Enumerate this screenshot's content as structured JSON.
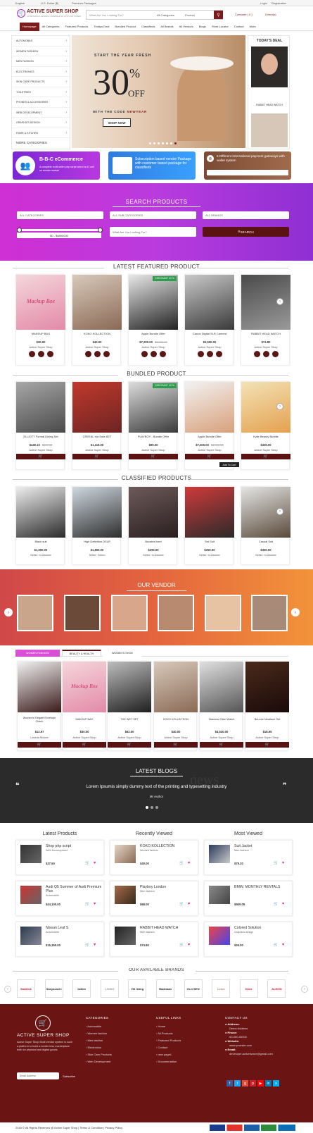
{
  "topbar": {
    "lang": "English",
    "currency": "U.S. Dollar ($)",
    "premium": "Premium Packages",
    "login": "Login",
    "register": "Registration"
  },
  "header": {
    "brand": "ACTIVE SUPER SHOP",
    "tagline": "ULTIMATE MULTI-VENDOR E-COMMERCE SOLUTION FOR OWNERS",
    "search_placeholder": "What Are You Looking For?",
    "category_select": "All Categories",
    "type_select": "Product",
    "compare": "Compare ( 0 )",
    "cart": "0 item(s)"
  },
  "nav": [
    "Homepage",
    "All Categories",
    "Featured Products",
    "Todays Deal",
    "Bundled Product",
    "Classifieds",
    "All Brands",
    "All Vendors",
    "Blogs",
    "Store Locator",
    "Contact",
    "More"
  ],
  "categories": [
    "AUTOMOBILE",
    "WOMEN FASHION",
    "MEN FASHION",
    "ELECTRONICS",
    "SKIN CARE PRODUCTS",
    "TOILETRIES",
    "PHONES & ACCESSORIES",
    "WEB DEVELOPMENT",
    "GRAPHICS DESIGN",
    "HOME & KITCHEN"
  ],
  "more_categories": "MORE CATEGORIES",
  "hero": {
    "line1": "START THE YEAR FRESH",
    "big": "30",
    "pct": "%",
    "off": "OFF",
    "code_text": "WITH THE CODE",
    "code": "NEWYEAR",
    "button": "SHOP NOW"
  },
  "todays_deal": {
    "title": "TODAY'S DEAL",
    "item": "RABBIT HEAD WATCH"
  },
  "promos": [
    {
      "title": "B-B-C eCommerce",
      "text": "A complete multi seller php script which is #1 sell on envato market"
    },
    {
      "text": "Subscription based vendor Package with customer based package for classifieds"
    },
    {
      "text": "5 Different International payment gateways with wallet system"
    }
  ],
  "search_products": {
    "title": "SEARCH PRODUCTS",
    "cat": "ALL CATEGORIES",
    "subcat": "ALL SUB CATEGORIES",
    "brand": "ALL BRANDS",
    "range": "$0 - $4890000",
    "placeholder": "What Are You Looking For?",
    "button": "SEARCH"
  },
  "featured": {
    "title": "LATEST FEATURED PRODUCT",
    "badge": "DISCOUNT 10 %",
    "items": [
      {
        "name": "MAKEUP BAG",
        "price": "$30.00",
        "old": "",
        "seller": "Active Super Shop",
        "img": "Mackup Box"
      },
      {
        "name": "KOKO KOLLECTION",
        "price": "$40.00",
        "old": "",
        "seller": "Active Super Shop",
        "img": ""
      },
      {
        "name": "Apple Bundle Offer",
        "price": "$7,200.00",
        "old": "$8,000.00",
        "seller": "Active Super Shop",
        "img": ""
      },
      {
        "name": "Canon Digital SLR Camera",
        "price": "$3,500.00",
        "old": "",
        "seller": "Active Super Shop",
        "img": ""
      },
      {
        "name": "RABBIT HEAD WATCH",
        "price": "$74.80",
        "old": "",
        "seller": "Active Super Shop",
        "img": ""
      }
    ]
  },
  "bundled": {
    "title": "BUNDLED PRODUCT",
    "badge": "DISCOUNT 10 %",
    "tooltip": "Add To Cart",
    "items": [
      {
        "name": "ELLIOTT Formal Dining Set",
        "price": "$449.10",
        "old": "$499.00",
        "seller": "Active Super Shop"
      },
      {
        "name": "CREEAL n/a Sofa SET",
        "price": "$1,119.00",
        "old": "",
        "seller": "Active Super Shop"
      },
      {
        "name": "PLAYBOY - Bundle Offer",
        "price": "$99.00",
        "old": "",
        "seller": "Active Super Shop"
      },
      {
        "name": "Apple Bundle Offer",
        "price": "$7,200.00",
        "old": "$8,000.00",
        "seller": "Active Super Shop"
      },
      {
        "name": "Kylie Beauty Bundle",
        "price": "$300.00",
        "old": "",
        "seller": "Active Super Shop"
      }
    ]
  },
  "classified": {
    "title": "CLASSIFIED PRODUCTS",
    "items": [
      {
        "name": "Black suit",
        "price": "$1,000.00",
        "seller": "Seller: Customer"
      },
      {
        "name": "High Definition DSLR",
        "price": "$1,800.00",
        "seller": "Seller: Demo"
      },
      {
        "name": "Boosted heel",
        "price": "$290.00",
        "seller": "Seller: Customer"
      },
      {
        "name": "Set Suit",
        "price": "$250.00",
        "seller": "Seller: Customer"
      },
      {
        "name": "Casual Suit",
        "price": "$350.00",
        "seller": "Seller: Customer"
      }
    ]
  },
  "vendor": {
    "title": "OUR VENDOR"
  },
  "tabs": {
    "labels": [
      "WOMEN FASHION",
      "BEAUTY & HEALTH",
      "WOMEN'S SHOE"
    ],
    "items": [
      {
        "name": "Women's Elegant Envelope Clutch",
        "price": "$12.97",
        "seller": "Lavinia Mckee",
        "img": ""
      },
      {
        "name": "MAKEUP BAG",
        "price": "$30.00",
        "seller": "Active Super Shop",
        "img": "Mackup Box"
      },
      {
        "name": "THE WET SET",
        "price": "$62.00",
        "seller": "Active Super Shop",
        "img": ""
      },
      {
        "name": "KOKO KOLLECTION",
        "price": "$40.00",
        "seller": "Active Super Shop",
        "img": ""
      },
      {
        "name": "Stainless Steel Watch",
        "price": "$4,530.00",
        "seller": "Active Super Shop",
        "img": ""
      },
      {
        "name": "BeLiore Necklace Set",
        "price": "$18.95",
        "seller": "Active Super Shop",
        "img": ""
      }
    ]
  },
  "blogs": {
    "title": "LATEST BLOGS",
    "text": "Lorem Ipsumis simply dummy text of the printing and typesetting industry",
    "author": "Mr Author"
  },
  "lists": {
    "latest": {
      "title": "Latest Products",
      "items": [
        {
          "name": "Shop php script",
          "cat": "Web Development",
          "price": "$37.50"
        },
        {
          "name": "Audi Q5 Summer of Audi Premium Plus",
          "cat": "Automobile",
          "price": "$44,100.00"
        },
        {
          "name": "Nissan Leaf S",
          "cat": "Automobile",
          "price": "$15,350.00"
        }
      ]
    },
    "recent": {
      "title": "Recently Viewed",
      "items": [
        {
          "name": "KOKO KOLLECTION",
          "cat": "Women fashion",
          "price": "$40.00"
        },
        {
          "name": "Playboy London",
          "cat": "Men fashion",
          "price": "$68.00"
        },
        {
          "name": "RABBIT HEAD WATCH",
          "cat": "Men fashion",
          "price": "$74.80"
        }
      ]
    },
    "most": {
      "title": "Most Viewed",
      "items": [
        {
          "name": "Suit Jacket",
          "cat": "Men fashion",
          "price": "$79.20"
        },
        {
          "name": "BMW: MONTHLY RENTALS",
          "cat": "",
          "price": "$909.09"
        },
        {
          "name": "Colored Solution",
          "cat": "Graphics design",
          "price": "$26.00"
        }
      ]
    }
  },
  "brands": {
    "title": "OUR AVAILABLE BRANDS",
    "items": [
      "SanDisk",
      "Sabyasachi",
      "belkin",
      "LIVING",
      "HK living",
      "Hackman",
      "GLO BEN",
      "Lotus",
      "Dixie",
      "ALESSI"
    ]
  },
  "footer": {
    "brand": "ACTIVE SUPER SHOP",
    "about": "Active Super Shop Multi vendor system is such a platform to build a border less marketplace both for physical and digital goods.",
    "email_placeholder": "Email Address",
    "subscribe": "Subscribe",
    "categories_title": "CATEGORIES",
    "categories": [
      "Automobile",
      "Women fashion",
      "Men fashion",
      "Electronics",
      "Skin Care Products",
      "Web Development"
    ],
    "links_title": "USEFUL LINKS",
    "links": [
      "Home",
      "All Products",
      "Featured Products",
      "Contact",
      "new page1",
      "Documentation"
    ],
    "contact_title": "CONTACT US",
    "address_label": "Address:",
    "address": "Demo Address",
    "phone_label": "Phone:",
    "phone": "00-000-00000",
    "website_label": "Website:",
    "website": "www.yoursite.com",
    "email_label": "Email:",
    "email": "developer.activeitzone@gmail.com",
    "copyright": "2018 © All Rights Reserved @ Active Super Shop | Terms & Condition | Privacy Policy"
  },
  "colors": {
    "maroon": "#6a1414",
    "purple": "#b32bd6",
    "orange": "#f0813a",
    "green": "#2e9b4d"
  }
}
